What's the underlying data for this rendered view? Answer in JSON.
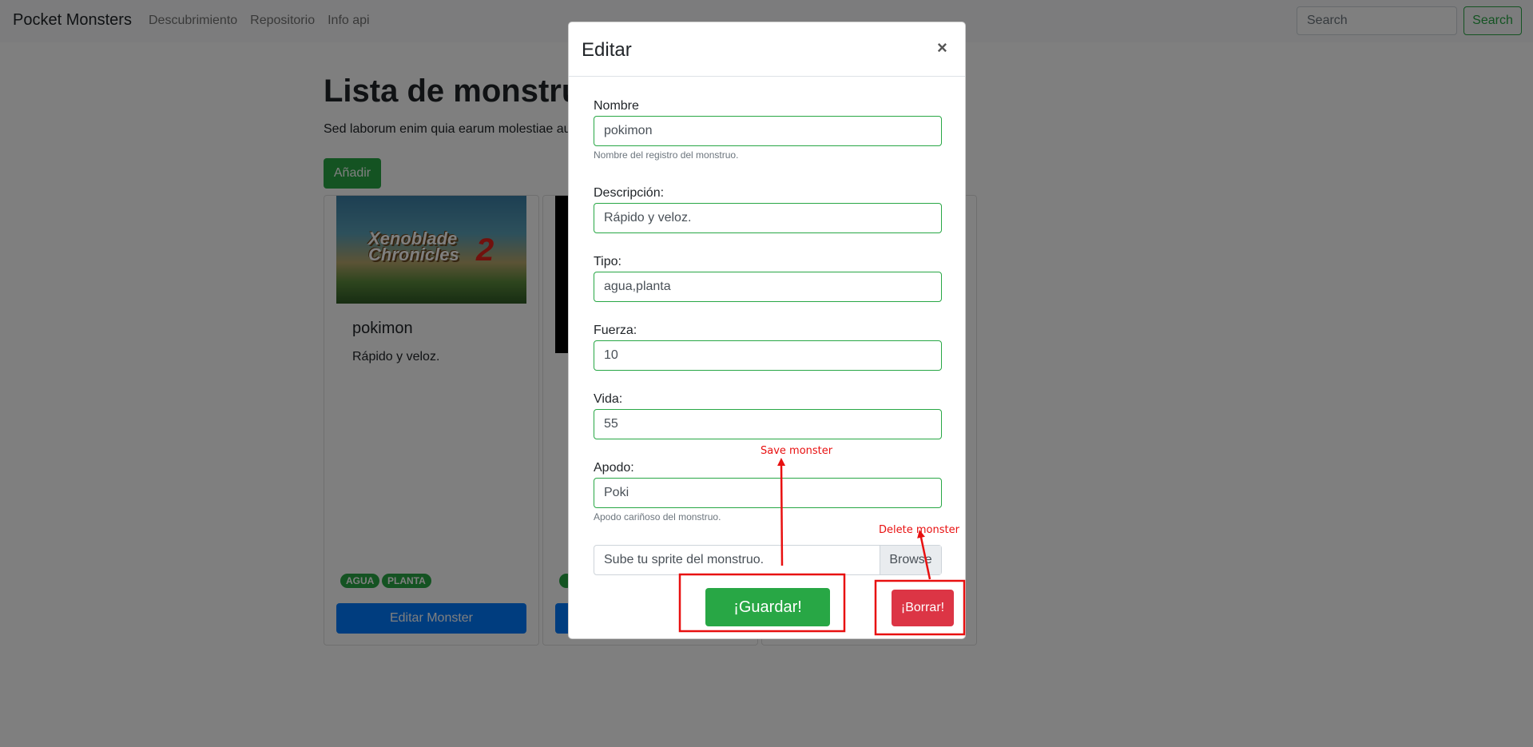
{
  "navbar": {
    "brand": "Pocket Monsters",
    "links": [
      "Descubrimiento",
      "Repositorio",
      "Info api"
    ],
    "search_placeholder": "Search",
    "search_button": "Search"
  },
  "page": {
    "title": "Lista de monstruo",
    "lead": "Sed laborum enim quia earum molestiae au",
    "add_button": "Añadir"
  },
  "cards": [
    {
      "image_text": "Xenoblade Chronicles",
      "image_number": "2",
      "title": "pokimon",
      "description": "Rápido y veloz.",
      "badges": [
        "AGUA",
        "PLANTA"
      ],
      "button": "Editar Monster"
    }
  ],
  "modal": {
    "title": "Editar",
    "close_symbol": "×",
    "fields": {
      "nombre": {
        "label": "Nombre",
        "value": "pokimon",
        "help": "Nombre del registro del monstruo."
      },
      "descripcion": {
        "label": "Descripción:",
        "value": "Rápido y veloz."
      },
      "tipo": {
        "label": "Tipo:",
        "value": "agua,planta"
      },
      "fuerza": {
        "label": "Fuerza:",
        "value": "10"
      },
      "vida": {
        "label": "Vida:",
        "value": "55"
      },
      "apodo": {
        "label": "Apodo:",
        "value": "Poki",
        "help": "Apodo cariñoso del monstruo."
      }
    },
    "file": {
      "label": "Sube tu sprite del monstruo.",
      "browse": "Browse"
    },
    "save_button": "¡Guardar!",
    "delete_button": "¡Borrar!"
  },
  "annotations": {
    "save": "Save monster",
    "delete": "Delete monster",
    "color": "#e81010"
  },
  "colors": {
    "success": "#28a745",
    "primary": "#007bff",
    "danger": "#dc3545"
  }
}
